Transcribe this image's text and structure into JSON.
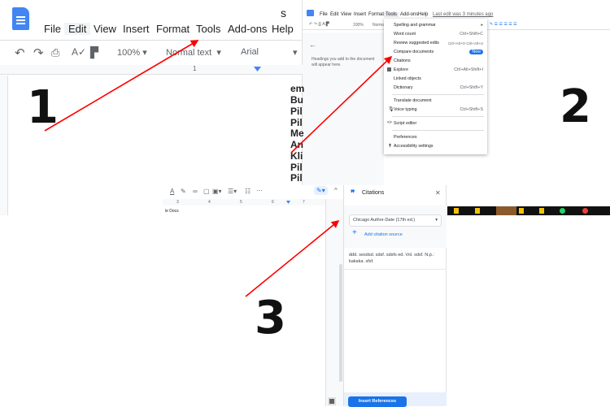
{
  "panel1": {
    "step": "1",
    "doc_title_fragment": "s",
    "menu": [
      "File",
      "Edit",
      "View",
      "Insert",
      "Format",
      "Tools",
      "Add-ons",
      "Help"
    ],
    "zoom": "100%",
    "style": "Normal text",
    "font": "Arial",
    "ruler_mark": "1",
    "icons": [
      "docs-logo-icon",
      "undo-icon",
      "redo-icon",
      "print-icon",
      "spellcheck-icon",
      "paint-format-icon"
    ]
  },
  "panel2": {
    "step": "2",
    "menu": [
      "File",
      "Edit",
      "View",
      "Insert",
      "Format",
      "Tools",
      "Add-ons",
      "Help"
    ],
    "last_edit": "Last edit was 3 minutes ago",
    "zoom": "100%",
    "style": "Normal",
    "outline_hint": "Headings you add to the document will appear here.",
    "tools_menu": [
      {
        "label": "Spelling and grammar",
        "shortcut": "▸"
      },
      {
        "label": "Word count",
        "shortcut": "Ctrl+Shift+C"
      },
      {
        "label": "Review suggested edits",
        "shortcut": "Ctrl+Alt+O Ctrl+Alt+U"
      },
      {
        "label": "Compare documents",
        "badge": "New"
      },
      {
        "label": "Citations"
      },
      {
        "label": "Explore",
        "shortcut": "Ctrl+Alt+Shift+I"
      },
      {
        "label": "Linked objects"
      },
      {
        "label": "Dictionary",
        "shortcut": "Ctrl+Shift+Y"
      },
      {
        "label": "Translate document"
      },
      {
        "label": "Voice typing",
        "shortcut": "Ctrl+Shift+S"
      },
      {
        "label": "Script editor"
      },
      {
        "label": "Preferences"
      },
      {
        "label": "Accessibility settings"
      }
    ],
    "doc_fragments": [
      "em",
      "Bu",
      "Pil",
      "Pil",
      "Me",
      "An",
      "Kli",
      "Pil",
      "Pil"
    ]
  },
  "panel3": {
    "step": "3",
    "doc_text_fragment": "le Docs",
    "ruler_marks": [
      "3",
      "4",
      "5",
      "6",
      "7"
    ],
    "citations": {
      "title": "Citations",
      "style_select": "Chicago Author-Date (17th ed.)",
      "add_source": "Add citation source",
      "entry": "ddd. sesdsd. sdsf. sdsfs ed. Vol. sdsf. N.p.: kakaka. sfsf.",
      "insert_button": "Insert References"
    }
  },
  "colors": {
    "arrow": "#ff0000",
    "accent": "#1a73e8",
    "docs_blue": "#4285f4"
  }
}
